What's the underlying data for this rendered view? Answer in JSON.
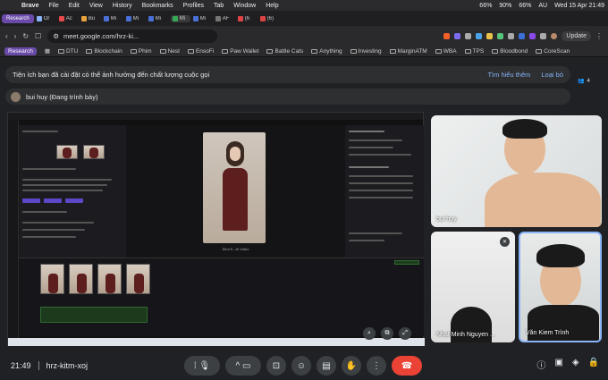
{
  "menubar": {
    "app": "Brave",
    "items": [
      "File",
      "Edit",
      "View",
      "History",
      "Bookmarks",
      "Profiles",
      "Tab",
      "Window",
      "Help"
    ],
    "battery1": "66%",
    "battery2": "90%",
    "battery3": "66%",
    "lang": "AU",
    "clock": "Wed 15 Apr 21:49"
  },
  "tabs": {
    "profile": "Research",
    "items": [
      "Or",
      "Ac",
      "Bu",
      "Mi",
      "Mi",
      "Mi",
      "Mi",
      "Mi",
      "AF",
      "(6",
      "(6)"
    ],
    "active": "Mi"
  },
  "address": {
    "url": "meet.google.com/hrz-ki...",
    "update": "Update"
  },
  "bookmarks": {
    "profile": "Research",
    "items": [
      "DTU",
      "Blockchain",
      "Phim",
      "Nest",
      "EnsoFi",
      "Paw Wallet",
      "Battle Cats",
      "Anything",
      "Investing",
      "MarginATM",
      "WBA",
      "TPS",
      "Bloodbond",
      "CoreScan"
    ]
  },
  "banner": {
    "text": "Tiện ích bạn đã cài đặt có thể ảnh hưởng đến chất lượng cuộc gọi",
    "learn": "Tìm hiểu thêm",
    "remove": "Loại bỏ"
  },
  "participants": {
    "count": "4"
  },
  "presenter": {
    "label": "bui huy (Đang trình bày)"
  },
  "share": {
    "clip": "Shot 5 - AI Video"
  },
  "tiles": [
    {
      "name": "bui huy"
    },
    {
      "name": "Nhat Minh Nguyen ..."
    },
    {
      "name": "Văn Kiem Trình"
    }
  ],
  "bottom": {
    "time": "21:49",
    "code": "hrz-kitm-xoj"
  },
  "colors": {
    "accent": "#8ab4f8",
    "end": "#ea4335",
    "research": "#6a4aa8"
  }
}
